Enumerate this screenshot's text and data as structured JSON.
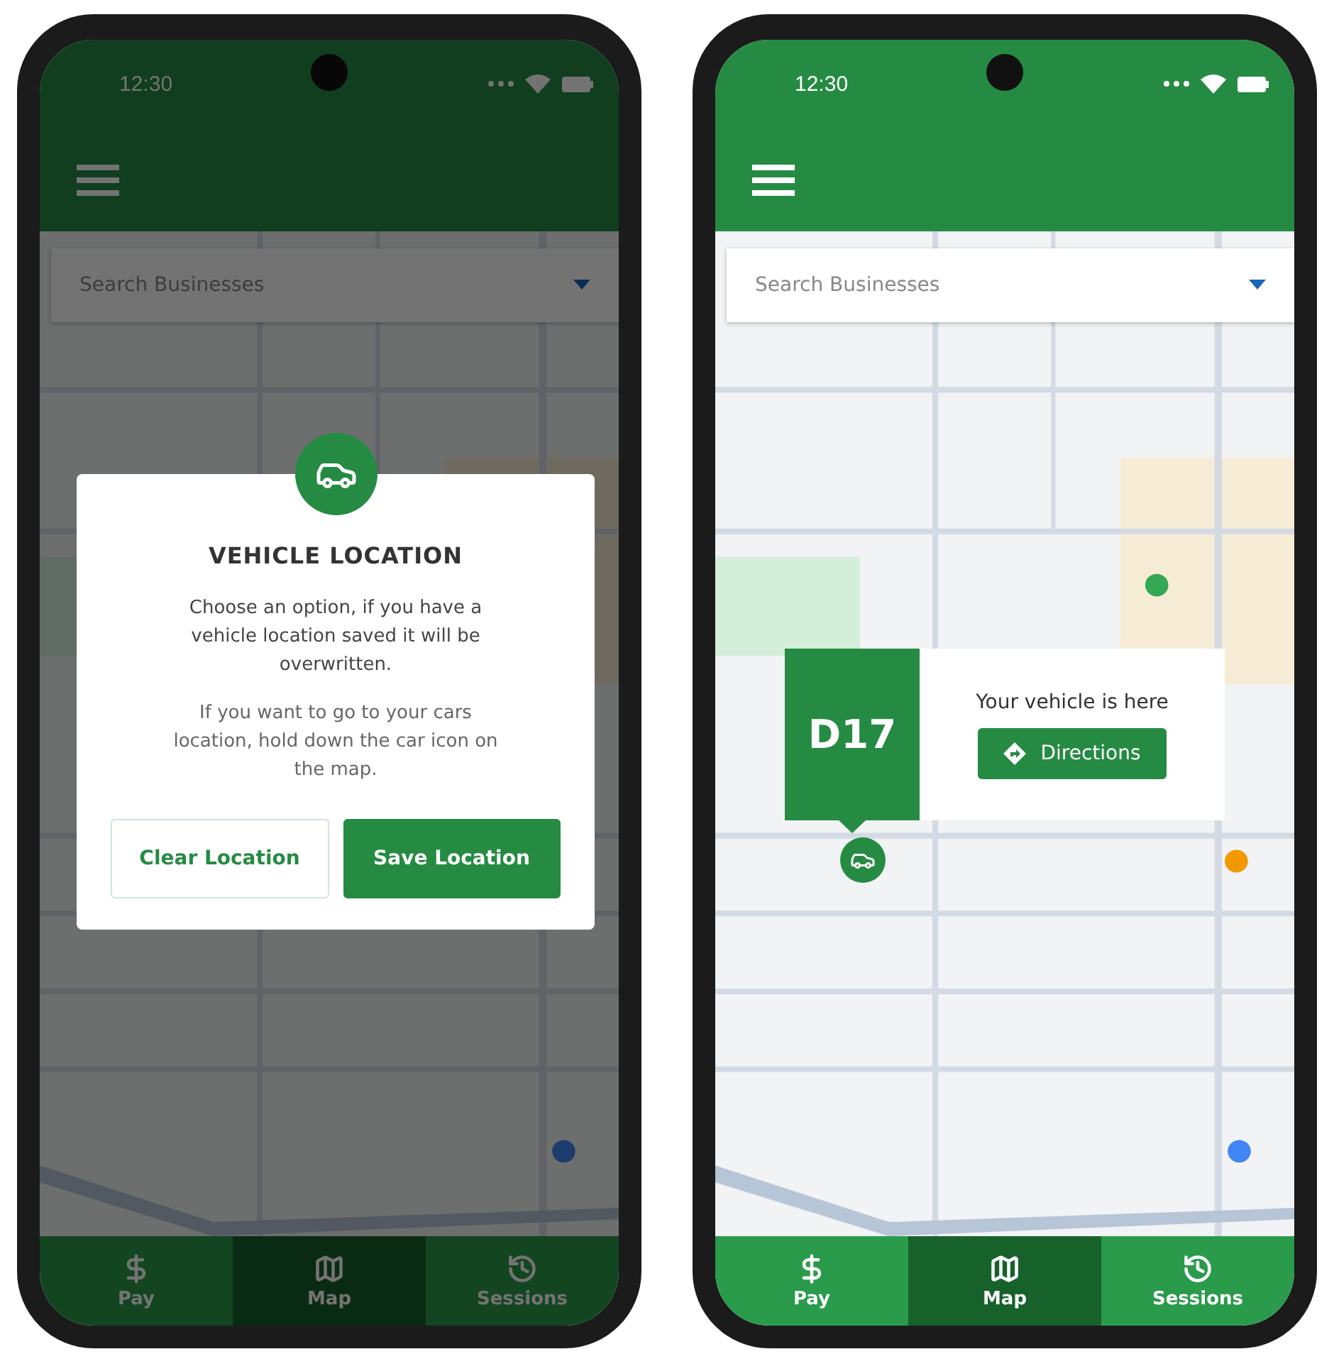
{
  "phones": [
    {
      "status_bar": {
        "time": "12:30"
      },
      "search": {
        "placeholder": "Search Businesses"
      },
      "dimmed": true,
      "dialog": {
        "title": "VEHICLE LOCATION",
        "paragraphs": [
          "Choose an option, if you have a vehicle location saved it will be overwritten.",
          "If you want to go to your cars location, hold down the car icon on the map."
        ],
        "buttons": [
          {
            "label": "Clear Location",
            "kind": "outline"
          },
          {
            "label": "Save Location",
            "kind": "primary"
          }
        ]
      },
      "nav": [
        {
          "label": "Pay",
          "selected": false
        },
        {
          "label": "Map",
          "selected": true
        },
        {
          "label": "Sessions",
          "selected": false
        }
      ]
    },
    {
      "status_bar": {
        "time": "12:30"
      },
      "search": {
        "placeholder": "Search Businesses"
      },
      "dimmed": false,
      "vehicle_callout": {
        "spot": "D17",
        "message": "Your vehicle is here",
        "button": "Directions"
      },
      "nav": [
        {
          "label": "Pay",
          "selected": false
        },
        {
          "label": "Map",
          "selected": true
        },
        {
          "label": "Sessions",
          "selected": false
        }
      ]
    }
  ]
}
